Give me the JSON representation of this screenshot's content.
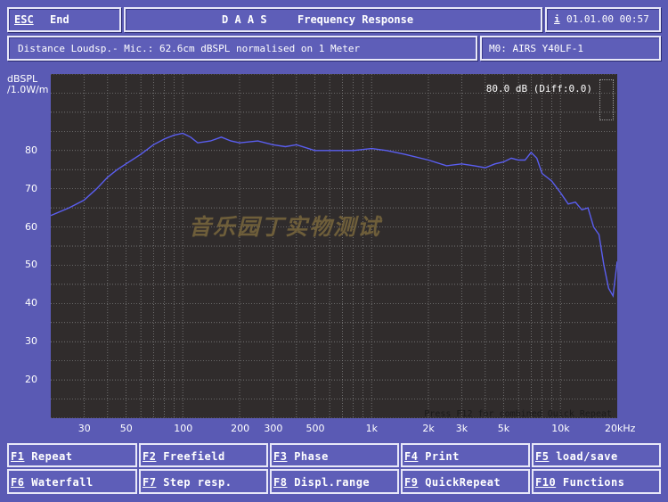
{
  "header": {
    "esc_key": "ESC",
    "end_label": "End",
    "daas_label": "D A A S",
    "title": "Frequency Response",
    "info_key": "i",
    "datetime": "01.01.00 00:57"
  },
  "info_bar": {
    "measurement": "Distance Loudsp.- Mic.: 62.6cm dBSPL normalised on 1 Meter",
    "mem_label": "M0: AIRS Y40LF-1"
  },
  "chart_data": {
    "type": "line",
    "ylabel": "dBSPL /1.0W/m",
    "xlabel": "",
    "x_scale": "log",
    "xlim": [
      20,
      20000
    ],
    "ylim": [
      10,
      100
    ],
    "x_tick_labels": [
      "30",
      "50",
      "100",
      "200",
      "300",
      "500",
      "1k",
      "2k",
      "3k",
      "5k",
      "10k",
      "20kHz"
    ],
    "x_tick_values": [
      30,
      50,
      100,
      200,
      300,
      500,
      1000,
      2000,
      3000,
      5000,
      10000,
      20000
    ],
    "y_tick_labels": [
      "80",
      "70",
      "60",
      "50",
      "40",
      "30",
      "20"
    ],
    "y_tick_values": [
      80,
      70,
      60,
      50,
      40,
      30,
      20
    ],
    "grid": true,
    "reference_readout": "80.0 dB (Diff:0.0)",
    "footer_note": "Press F12 for combined Quick Repeat",
    "watermark": "音乐园丁实物测试",
    "series": [
      {
        "color": "#5a5ef0",
        "x": [
          20,
          25,
          30,
          35,
          40,
          45,
          50,
          60,
          70,
          80,
          90,
          100,
          110,
          120,
          140,
          160,
          180,
          200,
          250,
          300,
          350,
          400,
          500,
          600,
          700,
          800,
          1000,
          1200,
          1500,
          2000,
          2500,
          3000,
          3500,
          4000,
          4500,
          5000,
          5500,
          6000,
          6500,
          7000,
          7500,
          8000,
          9000,
          10000,
          11000,
          12000,
          13000,
          14000,
          15000,
          16000,
          17000,
          18000,
          19000,
          20000
        ],
        "y": [
          63,
          65,
          67,
          70,
          73,
          75,
          76.5,
          79,
          81.5,
          83,
          84,
          84.5,
          83.5,
          82,
          82.5,
          83.5,
          82.5,
          82,
          82.5,
          81.5,
          81,
          81.5,
          80,
          80,
          80,
          80,
          80.5,
          80,
          79,
          77.5,
          76,
          76.5,
          76,
          75.5,
          76.5,
          77,
          78,
          77.5,
          77.5,
          79.5,
          78,
          74,
          72,
          69,
          66,
          66.5,
          64.5,
          65,
          60,
          58,
          50,
          44,
          42,
          51
        ]
      }
    ]
  }
}
